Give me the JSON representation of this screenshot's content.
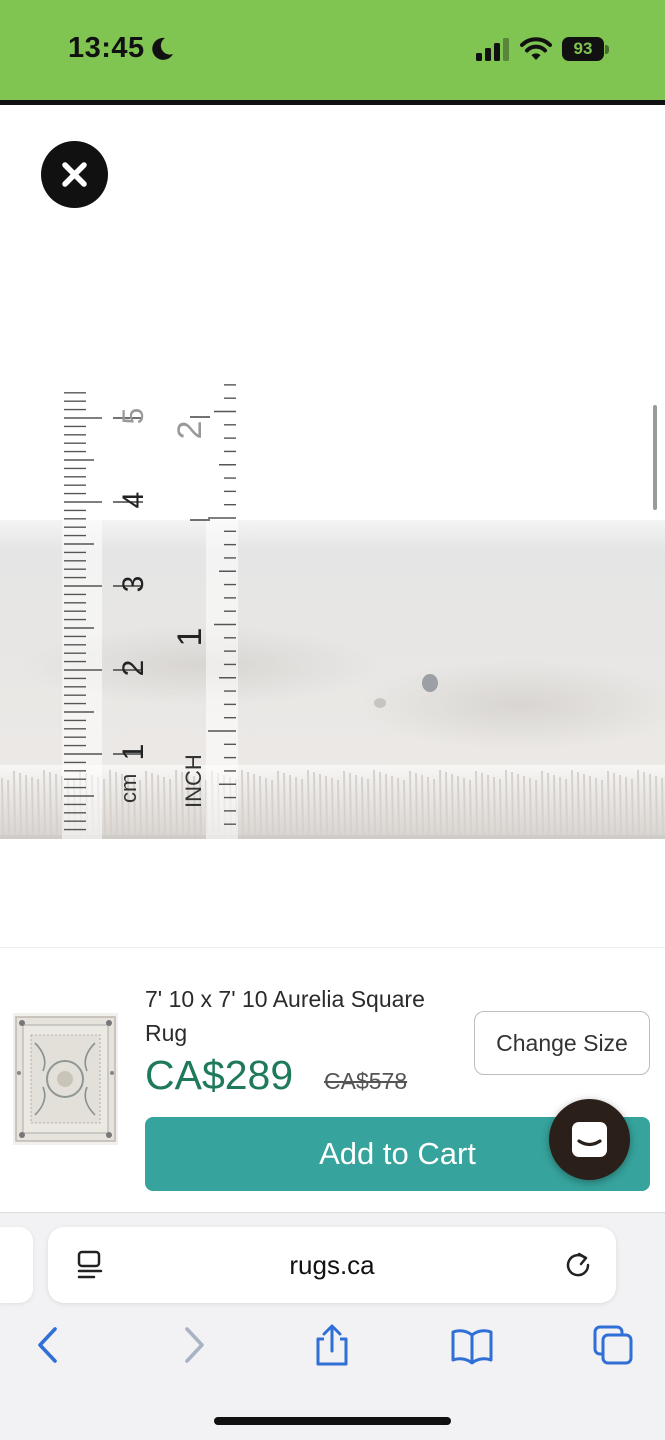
{
  "status_bar": {
    "time": "13:45",
    "battery": "93",
    "background": "#80c451"
  },
  "ruler": {
    "cm_label": "cm",
    "cm_numbers": [
      "1",
      "2",
      "3",
      "4",
      "5"
    ],
    "inch_label": "INCH",
    "inch_numbers": [
      "1",
      "2"
    ]
  },
  "product": {
    "title": "7' 10 x 7' 10 Aurelia Square Rug",
    "price": "CA$289",
    "old_price": "CA$578",
    "change_size_label": "Change Size",
    "add_to_cart_label": "Add to Cart",
    "accent_color": "#36a39c",
    "price_color": "#1f7a5c"
  },
  "browser": {
    "url": "rugs.ca"
  },
  "icons": {
    "close": "close-icon",
    "chat": "chat-icon",
    "reader": "reader-mode-icon",
    "reload": "reload-icon",
    "back": "back-icon",
    "forward": "forward-icon",
    "share": "share-icon",
    "bookmarks": "bookmarks-icon",
    "tabs": "tabs-icon"
  }
}
